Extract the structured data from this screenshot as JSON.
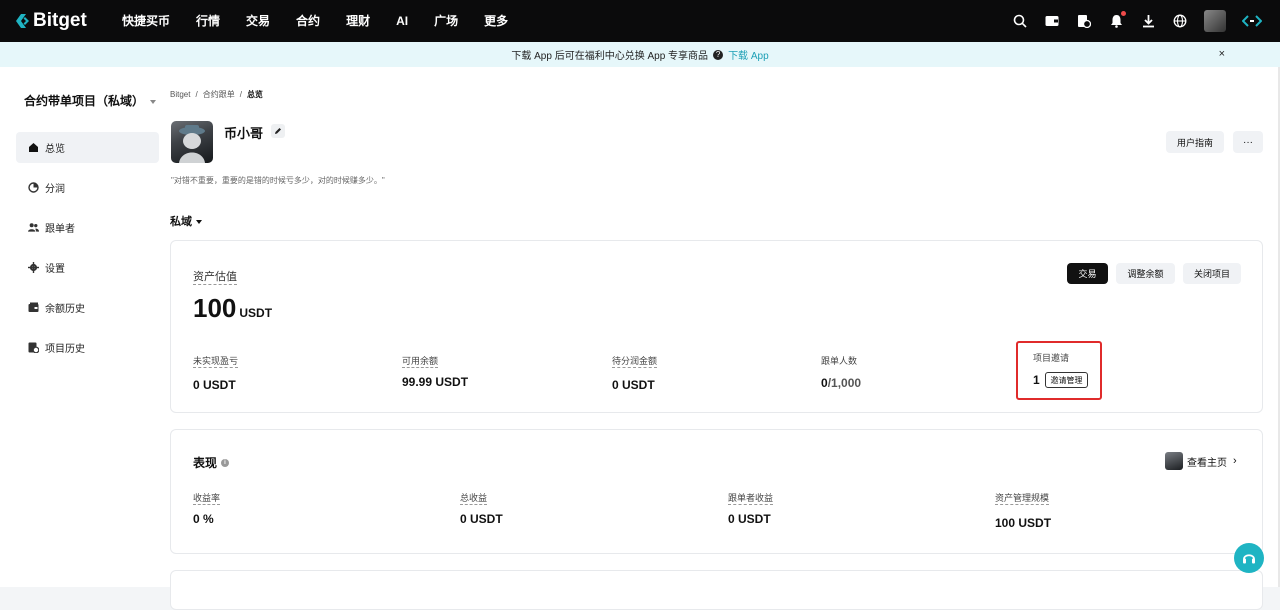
{
  "brand": {
    "name": "Bitget",
    "accent": "#1fb4c3"
  },
  "topnav": {
    "items": [
      "快捷买币",
      "行情",
      "交易",
      "合约",
      "理财",
      "AI",
      "广场",
      "更多"
    ],
    "icons": [
      "search-icon",
      "wallet-icon",
      "orders-icon",
      "bell-icon",
      "download-icon",
      "globe-icon",
      "avatar",
      "switch-icon"
    ]
  },
  "banner": {
    "text": "下载 App 后可在福利中心兑换 App 专享商品",
    "help": "?",
    "link": "下载 App",
    "close": "×"
  },
  "sidebar": {
    "title": "合约带单项目（私域）",
    "items": [
      {
        "label": "总览",
        "icon": "home-icon"
      },
      {
        "label": "分润",
        "icon": "pie-icon"
      },
      {
        "label": "跟单者",
        "icon": "users-icon"
      },
      {
        "label": "设置",
        "icon": "gear-icon"
      },
      {
        "label": "余额历史",
        "icon": "balance-history-icon"
      },
      {
        "label": "项目历史",
        "icon": "project-history-icon"
      }
    ]
  },
  "breadcrumb": [
    "Bitget",
    "合约跟单",
    "总览"
  ],
  "profile": {
    "name": "币小哥",
    "motto": "\"对错不重要，重要的是错的时候亏多少，对的时候赚多少。\"",
    "guide_button": "用户指南",
    "more_button": "···"
  },
  "scope": "私域",
  "assets": {
    "label": "资产估值",
    "value": "100",
    "unit": "USDT",
    "buttons": {
      "trade": "交易",
      "adjust": "调整余额",
      "close": "关闭项目"
    },
    "stats": [
      {
        "label": "未实现盈亏",
        "value": "0 USDT"
      },
      {
        "label": "可用余额",
        "value": "99.99 USDT"
      },
      {
        "label": "待分润金额",
        "value": "0 USDT"
      },
      {
        "label": "跟单人数",
        "value": "0",
        "suffix": "/1,000"
      }
    ],
    "invite": {
      "label": "项目邀请",
      "value": "1",
      "button": "邀请管理"
    }
  },
  "performance": {
    "title": "表现",
    "info": "i",
    "view_home": "查看主页",
    "stats": [
      {
        "label": "收益率",
        "value": "0 %"
      },
      {
        "label": "总收益",
        "value": "0 USDT"
      },
      {
        "label": "跟单者收益",
        "value": "0 USDT"
      },
      {
        "label": "资产管理规模",
        "value": "100 USDT"
      }
    ]
  }
}
